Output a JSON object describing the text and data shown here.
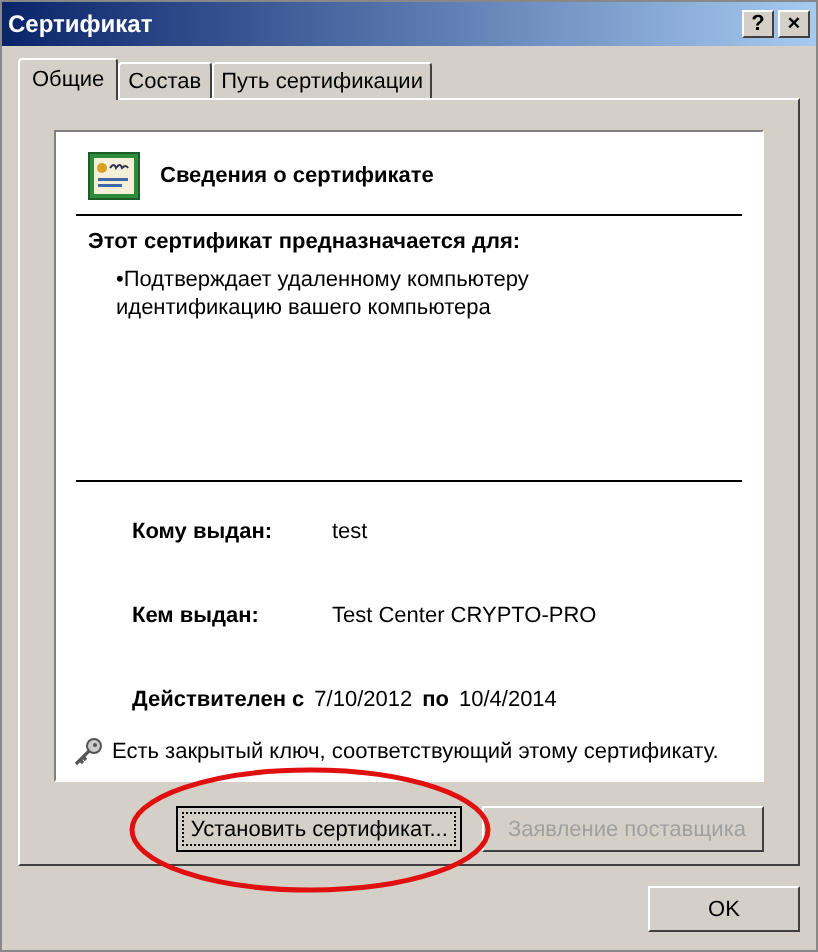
{
  "window": {
    "title": "Сертификат",
    "help_button": "?",
    "close_button": "×"
  },
  "tabs": [
    {
      "label": "Общие",
      "selected": true
    },
    {
      "label": "Состав",
      "selected": false
    },
    {
      "label": "Путь сертификации",
      "selected": false
    }
  ],
  "info": {
    "heading": "Сведения о сертификате",
    "purpose_title": "Этот сертификат предназначается для:",
    "purposes": [
      "•Подтверждает удаленному компьютеру идентификацию вашего компьютера"
    ],
    "issued_to_label": "Кому выдан:",
    "issued_to": "test",
    "issued_by_label": "Кем выдан:",
    "issued_by": "Test Center CRYPTO-PRO",
    "valid_from_label": "Действителен с",
    "valid_from": "7/10/2012",
    "valid_to_label": "по",
    "valid_to": "10/4/2014",
    "private_key_note": "Есть закрытый ключ, соответствующий этому сертификату."
  },
  "buttons": [
    {
      "label": "Установить сертификат...",
      "disabled": false,
      "focused": true
    },
    {
      "label": "Заявление поставщика",
      "disabled": true,
      "focused": false
    }
  ],
  "ok_button": "OK",
  "annotation": {
    "kind": "ellipse",
    "color": "#e01010"
  }
}
